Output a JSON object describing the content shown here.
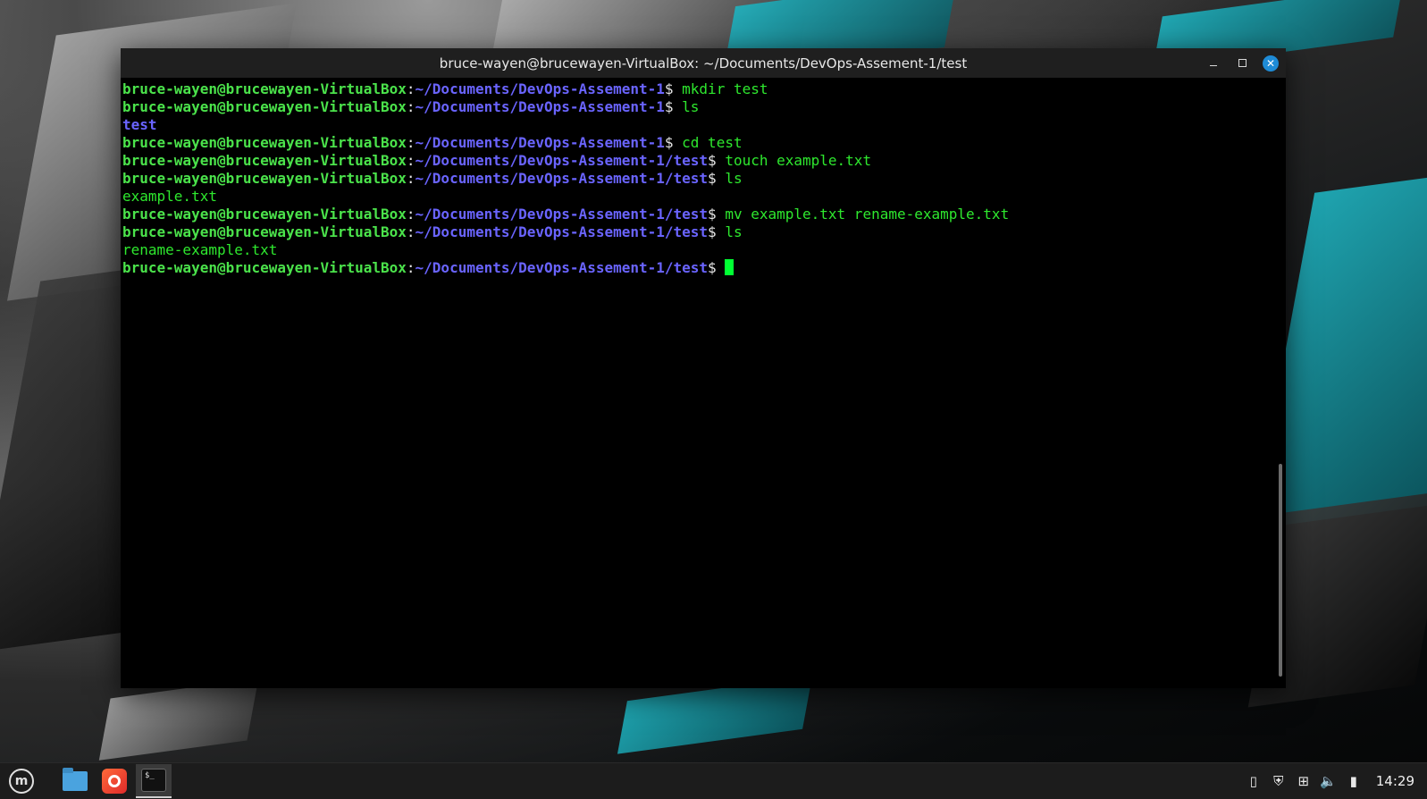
{
  "window": {
    "title": "bruce-wayen@brucewayen-VirtualBox: ~/Documents/DevOps-Assement-1/test"
  },
  "terminal": {
    "prompt_user": "bruce-wayen@brucewayen-VirtualBox",
    "lines": [
      {
        "type": "prompt",
        "path": "~/Documents/DevOps-Assement-1",
        "cmd": "mkdir test"
      },
      {
        "type": "prompt",
        "path": "~/Documents/DevOps-Assement-1",
        "cmd": "ls"
      },
      {
        "type": "dir",
        "text": "test"
      },
      {
        "type": "prompt",
        "path": "~/Documents/DevOps-Assement-1",
        "cmd": "cd test"
      },
      {
        "type": "prompt",
        "path": "~/Documents/DevOps-Assement-1/test",
        "cmd": "touch example.txt"
      },
      {
        "type": "prompt",
        "path": "~/Documents/DevOps-Assement-1/test",
        "cmd": "ls"
      },
      {
        "type": "out",
        "text": "example.txt"
      },
      {
        "type": "prompt",
        "path": "~/Documents/DevOps-Assement-1/test",
        "cmd": "mv example.txt rename-example.txt"
      },
      {
        "type": "prompt",
        "path": "~/Documents/DevOps-Assement-1/test",
        "cmd": "ls"
      },
      {
        "type": "out",
        "text": "rename-example.txt"
      },
      {
        "type": "prompt",
        "path": "~/Documents/DevOps-Assement-1/test",
        "cmd": "",
        "cursor": true
      }
    ]
  },
  "taskbar": {
    "apps": [
      {
        "name": "menu-button",
        "icon": "linux-mint-icon"
      },
      {
        "name": "files-launcher",
        "icon": "folder-icon"
      },
      {
        "name": "firefox-launcher",
        "icon": "firefox-icon"
      },
      {
        "name": "terminal-launcher",
        "icon": "terminal-icon",
        "active": true,
        "glyph": "$_"
      }
    ],
    "tray": [
      "clipboard-icon",
      "shield-icon",
      "network-icon",
      "volume-icon",
      "battery-icon"
    ],
    "clock": "14:29"
  },
  "colors": {
    "user": "#4be34b",
    "path": "#6a64ff",
    "command": "#2ee82e",
    "cursor": "#00ff33",
    "close_button": "#1e8bd6"
  }
}
